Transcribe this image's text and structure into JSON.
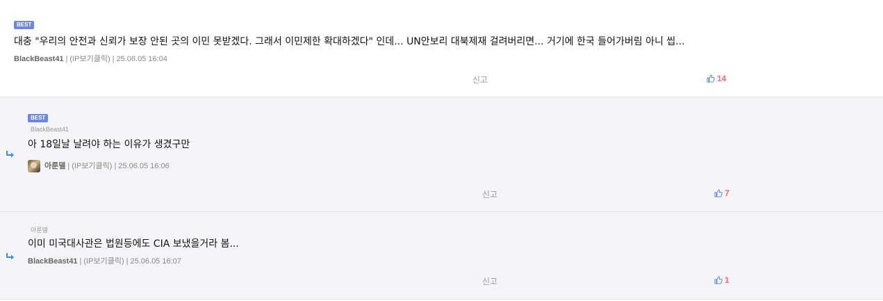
{
  "comments": [
    {
      "badge": "BEST",
      "text": "대충 \"우리의 안전과 신뢰가 보장 안된 곳의 이민 못받겠다. 그래서 이민제한 확대하겠다\" 인데... UN안보리 대북제재 걸려버리면... 거기에 한국 들어가버림 아니 씹...",
      "author": "BlackBeast41",
      "ip": "(IP보기클릭)",
      "date": "25.06.05 16:04",
      "report": "신고",
      "likes": "14"
    },
    {
      "badge": "BEST",
      "parent": "BlackBeast41",
      "text": "아 18일날 날려야 하는 이유가 생겼구만",
      "author": "아룬델",
      "ip": "(IP보기클릭)",
      "date": "25.06.05 16:06",
      "report": "신고",
      "likes": "7"
    },
    {
      "parent": "아룬델",
      "text": "이미 미국대사관은 법원등에도 CIA 보냈을거라 봄...",
      "author": "BlackBeast41",
      "ip": "(IP보기클릭)",
      "date": "25.06.05 16:07",
      "report": "신고",
      "likes": "1"
    }
  ],
  "separator": "|",
  "colors": {
    "best_badge": "#6f86e8",
    "like_count": "#ff6a6a",
    "thumb_icon": "#5b8de6",
    "reply_arrow": "#3a8ee6"
  }
}
